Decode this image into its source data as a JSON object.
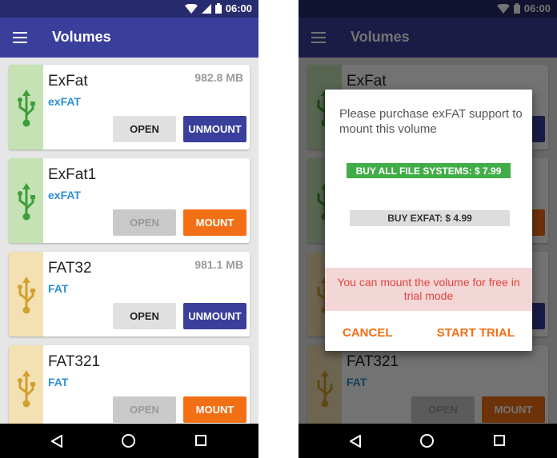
{
  "status_bar": {
    "time": "06:00",
    "wifi_icon": "wifi-icon",
    "signal_icon": "signal-icon",
    "battery_icon": "battery-icon"
  },
  "app_bar": {
    "title": "Volumes",
    "menu_icon": "menu-icon"
  },
  "volumes": [
    {
      "name": "ExFat",
      "fs": "exFAT",
      "size": "982.8 MB",
      "open_label": "OPEN",
      "action_label": "UNMOUNT",
      "mounted": true,
      "strip_color": "#c4e2b4",
      "icon_color": "#3e9e3a"
    },
    {
      "name": "ExFat1",
      "fs": "exFAT",
      "size": "",
      "open_label": "OPEN",
      "action_label": "MOUNT",
      "mounted": false,
      "strip_color": "#c4e2b4",
      "icon_color": "#3e9e3a"
    },
    {
      "name": "FAT32",
      "fs": "FAT",
      "size": "981.1 MB",
      "open_label": "OPEN",
      "action_label": "UNMOUNT",
      "mounted": true,
      "strip_color": "#f3e1b3",
      "icon_color": "#d2a02e"
    },
    {
      "name": "FAT321",
      "fs": "FAT",
      "size": "",
      "open_label": "OPEN",
      "action_label": "MOUNT",
      "mounted": false,
      "strip_color": "#f3e1b3",
      "icon_color": "#d2a02e"
    }
  ],
  "dialog": {
    "message": "Please purchase exFAT support to mount this volume",
    "buy_all_label": "BUY ALL FILE SYSTEMS: $ 7.99",
    "buy_exfat_label": "BUY EXFAT: $ 4.99",
    "trial_note": "You can mount the volume for free in trial mode",
    "cancel_label": "CANCEL",
    "start_trial_label": "START TRIAL"
  },
  "nav_bar": {
    "back_icon": "back-icon",
    "home_icon": "home-icon",
    "recents_icon": "recents-icon"
  },
  "colors": {
    "primary": "#3a3f9c",
    "primary_dark": "#272c6e",
    "accent": "#f36f16",
    "buy_green": "#42ad48",
    "fs_blue": "#2f8fd4",
    "trial_red": "#e0443b"
  }
}
